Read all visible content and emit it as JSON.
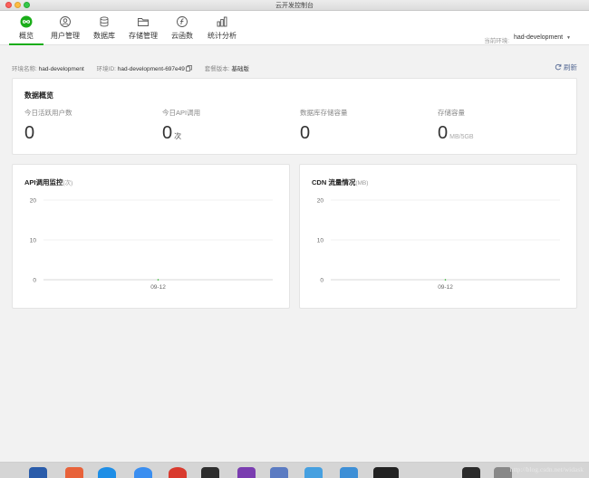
{
  "window": {
    "title": "云开发控制台"
  },
  "nav": {
    "tabs": [
      {
        "label": "概览",
        "icon": "infinity-icon"
      },
      {
        "label": "用户管理",
        "icon": "user-icon"
      },
      {
        "label": "数据库",
        "icon": "database-icon"
      },
      {
        "label": "存储管理",
        "icon": "folder-icon"
      },
      {
        "label": "云函数",
        "icon": "function-icon"
      },
      {
        "label": "统计分析",
        "icon": "bar-chart-icon"
      }
    ],
    "active_index": 0,
    "env_label": "当前环境:",
    "env_value": "had-development"
  },
  "env_info": {
    "name_label": "环境名称:",
    "name_value": "had-development",
    "id_label": "环境ID:",
    "id_value": "had-development-697e49",
    "plan_label": "套餐版本:",
    "plan_value": "基础版",
    "refresh_label": "刷新"
  },
  "overview": {
    "title": "数据概览",
    "metrics": [
      {
        "label": "今日活跃用户数",
        "value": "0",
        "unit": ""
      },
      {
        "label": "今日API调用",
        "value": "0",
        "unit": "次"
      },
      {
        "label": "数据库存储容量",
        "value": "0",
        "unit": ""
      },
      {
        "label": "存储容量",
        "value": "0",
        "unit": "MB/5GB"
      }
    ]
  },
  "charts": {
    "api": {
      "title": "API调用监控",
      "unit": "(次)"
    },
    "cdn": {
      "title": "CDN 流量情况",
      "unit": "(MB)"
    }
  },
  "chart_data": [
    {
      "type": "line",
      "title": "API调用监控(次)",
      "x": [
        "09-12"
      ],
      "series": [
        {
          "values": [
            0
          ]
        }
      ],
      "yticks": [
        0,
        10,
        20
      ],
      "ylim": [
        0,
        20
      ],
      "grid": true
    },
    {
      "type": "line",
      "title": "CDN 流量情况(MB)",
      "x": [
        "09-12"
      ],
      "series": [
        {
          "values": [
            0
          ]
        }
      ],
      "yticks": [
        0,
        10,
        20
      ],
      "ylim": [
        0,
        20
      ],
      "grid": true
    }
  ],
  "footer": {
    "watermark": "http://blog.csdn.net/widask"
  },
  "colors": {
    "accent": "#1aad19",
    "link": "#576b95"
  }
}
